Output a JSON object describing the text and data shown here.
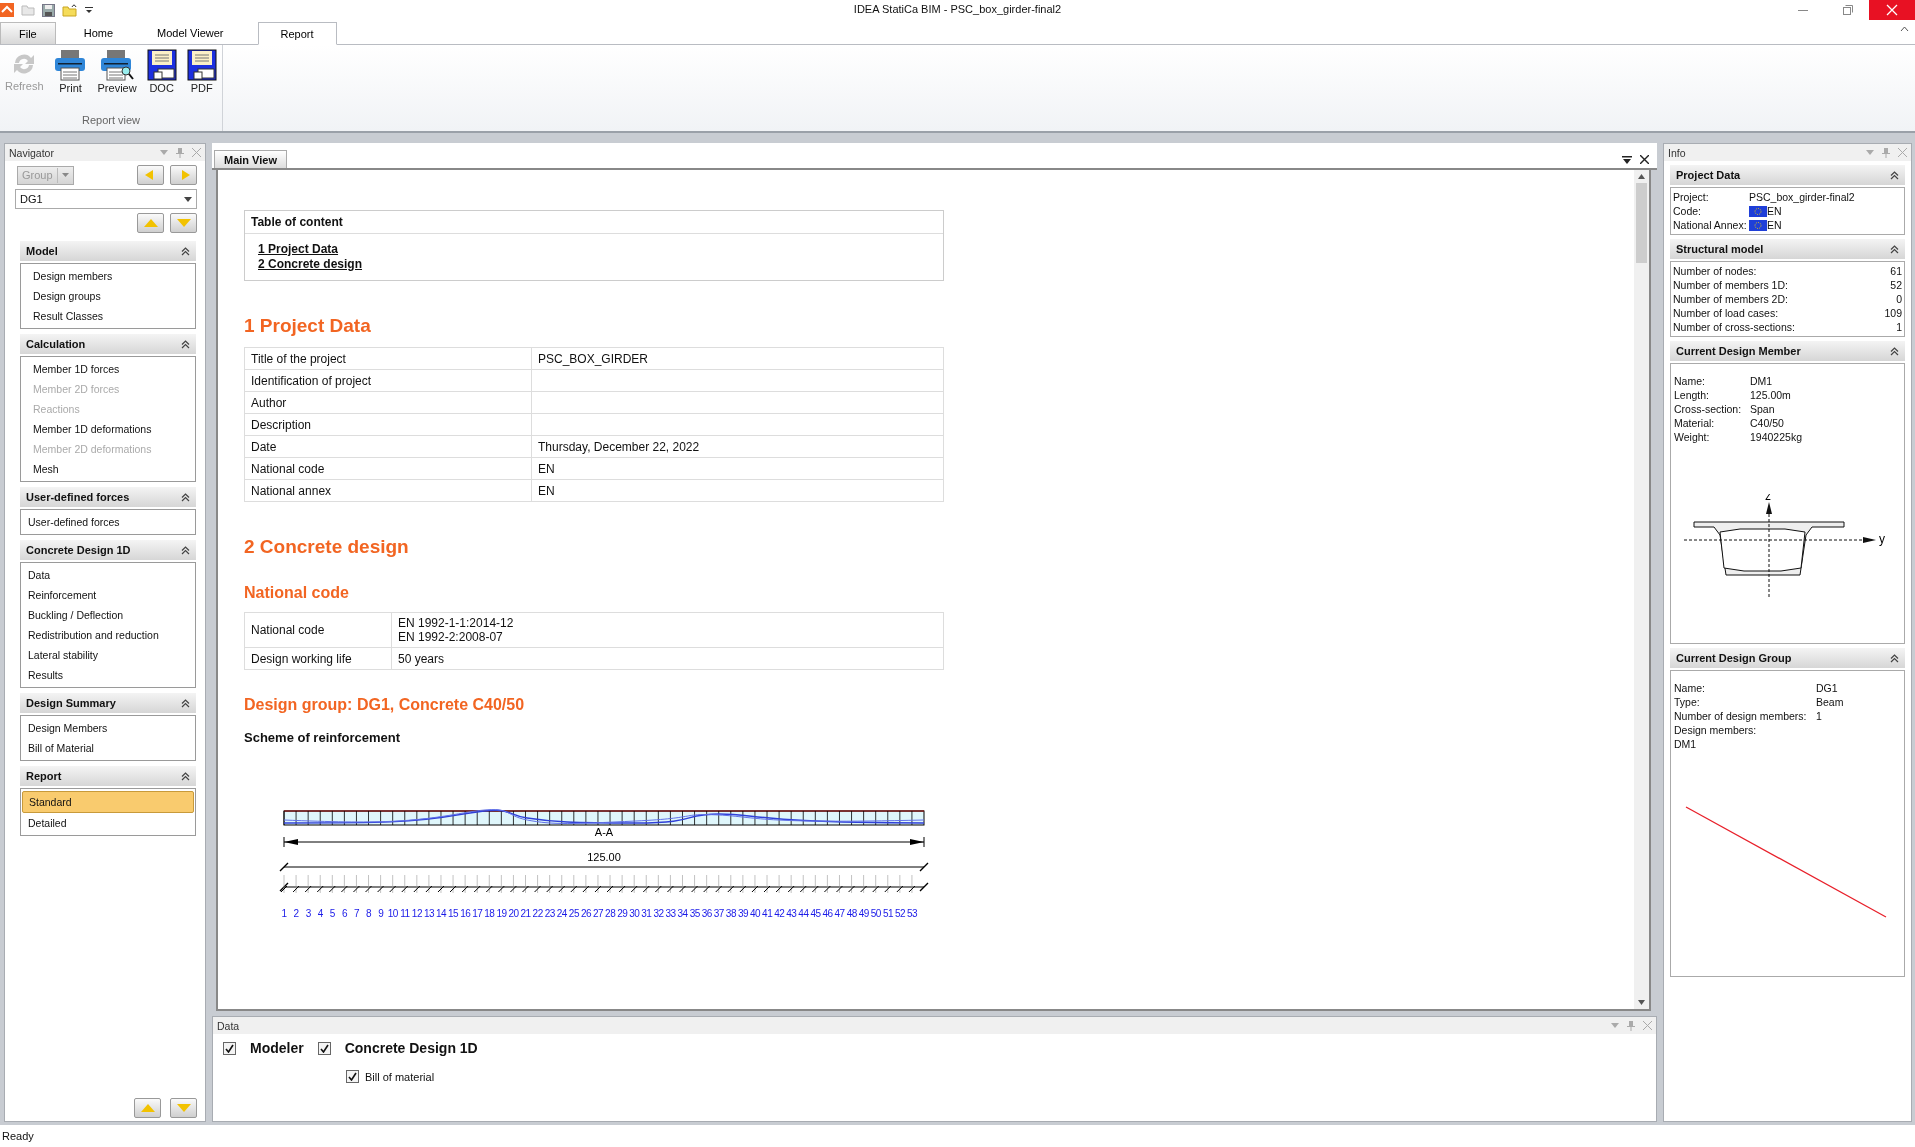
{
  "window": {
    "title": "IDEA StatiCa BIM - PSC_box_girder-final2"
  },
  "ribbon_tabs": [
    {
      "label": "File",
      "selected": false
    },
    {
      "label": "Home",
      "selected": false
    },
    {
      "label": "Model Viewer",
      "selected": false
    },
    {
      "label": "Report",
      "selected": true
    }
  ],
  "ribbon": {
    "group_label": "Report view",
    "buttons": [
      {
        "label": "Refresh",
        "kind": "refresh",
        "disabled": true
      },
      {
        "label": "Print",
        "kind": "printer",
        "disabled": false
      },
      {
        "label": "Preview",
        "kind": "printer-preview",
        "disabled": false
      },
      {
        "label": "DOC",
        "kind": "floppy",
        "disabled": false
      },
      {
        "label": "PDF",
        "kind": "floppy",
        "disabled": false
      }
    ]
  },
  "navigator": {
    "title": "Navigator",
    "group_button": "Group",
    "selector_value": "DG1",
    "sections": [
      {
        "title": "Model",
        "items": [
          {
            "label": "Design members",
            "disabled": false,
            "selected": false
          },
          {
            "label": "Design groups",
            "disabled": false,
            "selected": false
          },
          {
            "label": "Result Classes",
            "disabled": false,
            "selected": false
          }
        ]
      },
      {
        "title": "Calculation",
        "items": [
          {
            "label": "Member 1D forces",
            "disabled": false,
            "selected": false
          },
          {
            "label": "Member 2D forces",
            "disabled": true,
            "selected": false
          },
          {
            "label": "Reactions",
            "disabled": true,
            "selected": false
          },
          {
            "label": "Member 1D deformations",
            "disabled": false,
            "selected": false
          },
          {
            "label": "Member 2D deformations",
            "disabled": true,
            "selected": false
          },
          {
            "label": "Mesh",
            "disabled": false,
            "selected": false
          }
        ]
      },
      {
        "title": "User-defined forces",
        "items": [
          {
            "label": "User-defined forces",
            "disabled": false,
            "selected": false
          }
        ]
      },
      {
        "title": "Concrete Design 1D",
        "items": [
          {
            "label": "Data",
            "disabled": false,
            "selected": false
          },
          {
            "label": "Reinforcement",
            "disabled": false,
            "selected": false
          },
          {
            "label": "Buckling / Deflection",
            "disabled": false,
            "selected": false
          },
          {
            "label": "Redistribution and reduction",
            "disabled": false,
            "selected": false
          },
          {
            "label": "Lateral stability",
            "disabled": false,
            "selected": false
          },
          {
            "label": "Results",
            "disabled": false,
            "selected": false
          }
        ]
      },
      {
        "title": "Design Summary",
        "items": [
          {
            "label": "Design Members",
            "disabled": false,
            "selected": false
          },
          {
            "label": "Bill of Material",
            "disabled": false,
            "selected": false
          }
        ]
      },
      {
        "title": "Report",
        "items": [
          {
            "label": "Standard",
            "disabled": false,
            "selected": true
          },
          {
            "label": "Detailed",
            "disabled": false,
            "selected": false
          }
        ]
      }
    ]
  },
  "main_view": {
    "tab": "Main View",
    "toc": {
      "title": "Table of content",
      "links": [
        "1 Project Data",
        "2 Concrete design"
      ]
    },
    "project_heading": "1 Project Data",
    "project_rows": [
      {
        "label": "Title of the project",
        "value": "PSC_BOX_GIRDER"
      },
      {
        "label": "Identification of project"
      },
      {
        "label": "Author"
      },
      {
        "label": "Description"
      },
      {
        "label": "Date",
        "value": "Thursday, December 22, 2022"
      },
      {
        "label": "National code",
        "value": "EN"
      },
      {
        "label": "National annex",
        "value": "EN"
      }
    ],
    "design_heading": "2 Concrete design",
    "code_heading": "National code",
    "code_rows": [
      {
        "label": "National code",
        "values": [
          "EN 1992-1-1:2014-12",
          "EN 1992-2:2008-07"
        ]
      },
      {
        "label": "Design working life",
        "values": [
          "50 years"
        ]
      }
    ],
    "group_heading": "Design group: DG1, Concrete C40/50",
    "scheme_title": "Scheme of reinforcement",
    "scheme": {
      "section_label": "A-A",
      "total_length": "125.00",
      "element_numbers": [
        "1",
        "2",
        "3",
        "4",
        "5",
        "6",
        "7",
        "8",
        "9",
        "10",
        "11",
        "12",
        "13",
        "14",
        "15",
        "16",
        "17",
        "18",
        "19",
        "20",
        "21",
        "22",
        "23",
        "24",
        "25",
        "26",
        "27",
        "28",
        "29",
        "30",
        "31",
        "32",
        "33",
        "34",
        "35",
        "36",
        "37",
        "38",
        "39",
        "40",
        "41",
        "42",
        "43",
        "44",
        "45",
        "46",
        "47",
        "48",
        "49",
        "50",
        "51",
        "52",
        "53"
      ]
    }
  },
  "data_panel": {
    "title": "Data",
    "options": [
      {
        "label": "Modeler",
        "checked": true,
        "kind": "main"
      },
      {
        "label": "Concrete Design 1D",
        "checked": true,
        "kind": "main"
      },
      {
        "label": "Bill of material",
        "checked": true,
        "kind": "sub"
      }
    ]
  },
  "info": {
    "title": "Info",
    "project_data": {
      "title": "Project Data",
      "rows": [
        {
          "label": "Project:",
          "value": "PSC_box_girder-final2",
          "flag": false
        },
        {
          "label": "Code:",
          "value": "EN",
          "flag": true
        },
        {
          "label": "National Annex:",
          "value": "EN",
          "flag": true
        }
      ]
    },
    "structural_model": {
      "title": "Structural model",
      "rows": [
        {
          "label": "Number of nodes:",
          "value": "61"
        },
        {
          "label": "Number of members 1D:",
          "value": "52"
        },
        {
          "label": "Number of members 2D:",
          "value": "0"
        },
        {
          "label": "Number of load cases:",
          "value": "109"
        },
        {
          "label": "Number of cross-sections:",
          "value": "1"
        }
      ]
    },
    "design_member": {
      "title": "Current Design Member",
      "rows": [
        {
          "label": "Name:",
          "value": "DM1"
        },
        {
          "label": "Length:",
          "value": "125.00m"
        },
        {
          "label": "Cross-section:",
          "value": "Span"
        },
        {
          "label": "Material:",
          "value": "C40/50"
        },
        {
          "label": "Weight:",
          "value": "1940225kg"
        }
      ],
      "axes": {
        "vertical": "z",
        "horizontal": "y"
      }
    },
    "design_group": {
      "title": "Current Design Group",
      "rows": [
        {
          "label": "Name:",
          "value": "DG1"
        },
        {
          "label": "Type:",
          "value": "Beam"
        },
        {
          "label": "Number of design members:",
          "value": "1"
        },
        {
          "label": "Design members:"
        }
      ],
      "members": [
        "DM1"
      ]
    }
  },
  "status_bar": "Ready"
}
